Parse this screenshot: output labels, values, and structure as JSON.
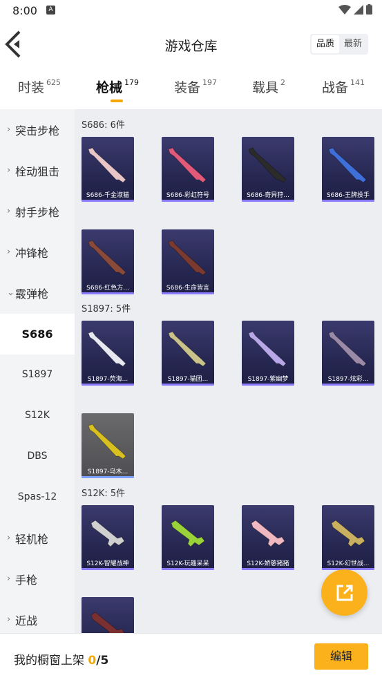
{
  "status_bar": {
    "time": "8:00",
    "notif_icon": "A"
  },
  "header": {
    "title": "游戏仓库",
    "sort": [
      "品质",
      "最新"
    ],
    "sort_active": 0
  },
  "tabs": [
    {
      "label": "时装",
      "count": "625"
    },
    {
      "label": "枪械",
      "count": "179"
    },
    {
      "label": "装备",
      "count": "197"
    },
    {
      "label": "载具",
      "count": "2"
    },
    {
      "label": "战备",
      "count": "141"
    }
  ],
  "active_tab": 1,
  "sidebar": {
    "categories": [
      "突击步枪",
      "栓动狙击",
      "射手步枪",
      "冲锋枪",
      "霰弹枪"
    ],
    "subitems": [
      "S686",
      "S1897",
      "S12K",
      "DBS",
      "Spas-12"
    ],
    "more": [
      "轻机枪",
      "手枪",
      "近战"
    ]
  },
  "groups": [
    {
      "title": "S686: 6件",
      "items": [
        "S686-千金淑猫",
        "S686-彩虹符号",
        "S686-奇异狩...",
        "S686-王牌投手",
        "S686-红色方...",
        "S686-生命皆言"
      ]
    },
    {
      "title": "S1897: 5件",
      "items": [
        "S1897-荧海...",
        "S1897-猫团...",
        "S1897-紫幽梦",
        "S1897-炫彩...",
        "S1897-乌木..."
      ]
    },
    {
      "title": "S12K: 5件",
      "items": [
        "S12K-智耀战神",
        "S12K-玩趣呆呆",
        "S12K-娇憨猪猪",
        "S12K-幻世战..."
      ]
    }
  ],
  "bottom": {
    "label": "我的橱窗上架 ",
    "count": "0",
    "total": "/5",
    "edit": "编辑"
  },
  "colors": {
    "accent": "#fbb11b",
    "card_bg": "#272852"
  },
  "icons": {
    "back": "chevron-left-icon",
    "share": "share-icon"
  }
}
